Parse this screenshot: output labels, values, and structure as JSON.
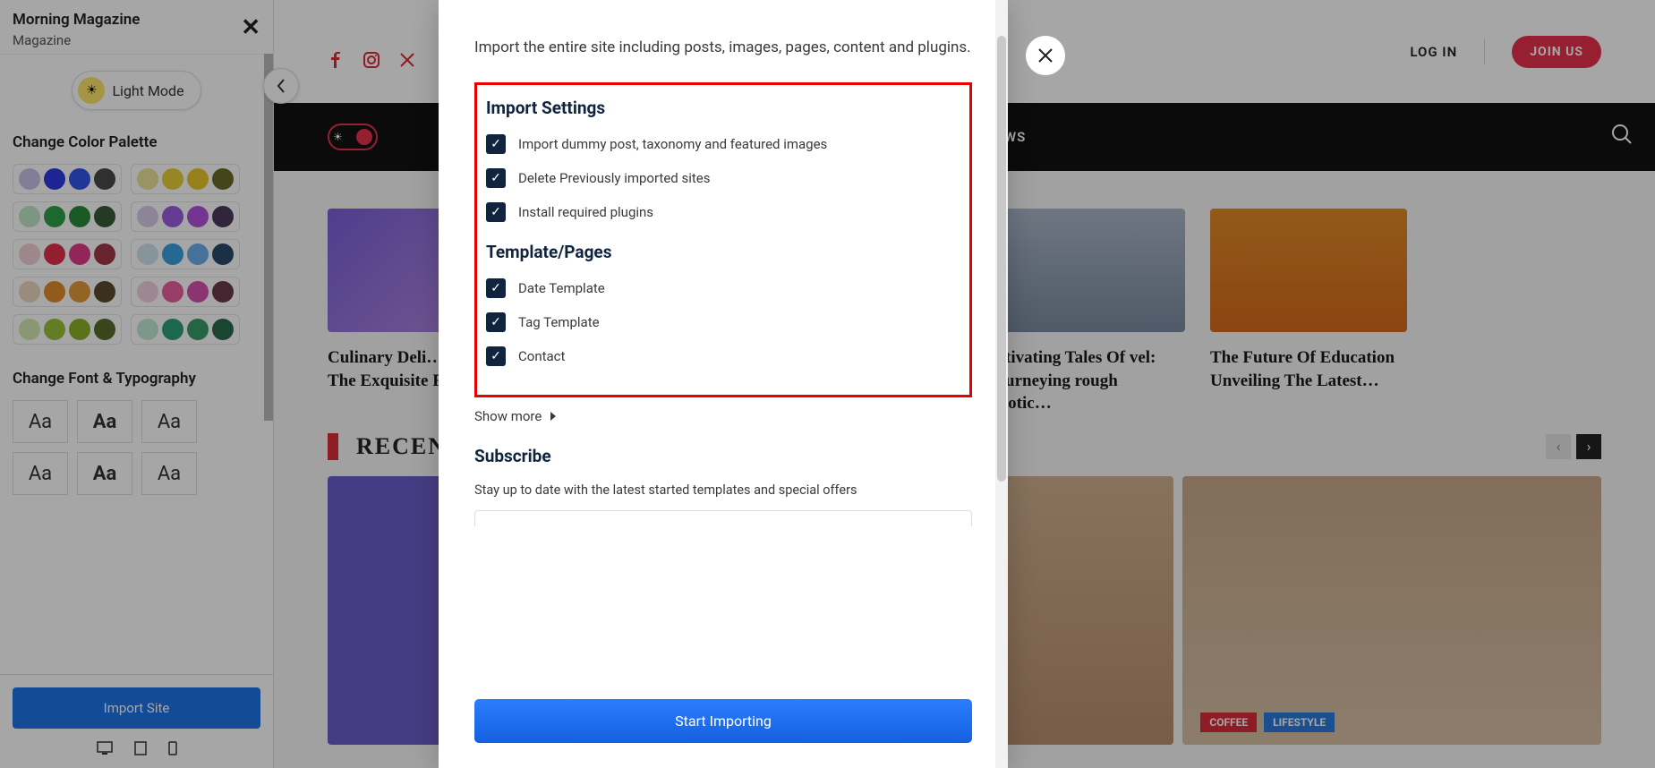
{
  "sidebar": {
    "title": "Morning Magazine",
    "subtitle": "Magazine",
    "light_mode": "Light Mode",
    "palette_label": "Change Color Palette",
    "font_label": "Change Font & Typography",
    "import_btn": "Import Site",
    "palettes": [
      [
        [
          "#c6c4ea",
          "#2b3adf",
          "#3355e8",
          "#4a4a4a"
        ],
        [
          "#ece39a",
          "#e6cf3a",
          "#e8c72a",
          "#6b6b2a"
        ]
      ],
      [
        [
          "#bfe6c7",
          "#2ea04a",
          "#2a8a3a",
          "#3a5a3a"
        ],
        [
          "#d8ccea",
          "#9a5fe0",
          "#b44fe0",
          "#4a3a5a"
        ]
      ],
      [
        [
          "#f2cfd4",
          "#e0314a",
          "#e03a8a",
          "#a03a4a"
        ],
        [
          "#cfe3ee",
          "#3aa0e0",
          "#6ab0ea",
          "#2a4a6a"
        ]
      ],
      [
        [
          "#ead9c0",
          "#e08a2a",
          "#e09a3a",
          "#5a4a2a"
        ],
        [
          "#f2cfe0",
          "#ea5fa0",
          "#d84fb0",
          "#6a3a4a"
        ]
      ],
      [
        [
          "#d6e8b0",
          "#9ac03a",
          "#8ab02a",
          "#5a6a2a"
        ],
        [
          "#c0ead6",
          "#2aa07a",
          "#3a9a6a",
          "#2a6a4a"
        ]
      ]
    ]
  },
  "preview": {
    "login": "LOG IN",
    "joinus": "JOIN US",
    "nav_link": "WS",
    "cards": [
      {
        "title": "Culinary Deli… Exploring The Exquisite Flav…",
        "bg": "linear-gradient(135deg,#7a5fd9,#b88fe0)"
      },
      {
        "title": "…tivating Tales Of vel: Journeying rough Exotic…",
        "bg": "linear-gradient(#aab6c8,#7a8aa0)"
      },
      {
        "title": "The Future Of Education Unveiling The Latest…",
        "bg": "linear-gradient(#e08a2a,#d86a1a)"
      }
    ],
    "recent": "RECENT",
    "chips": [
      "COFFEE",
      "LIFESTYLE"
    ]
  },
  "modal": {
    "description": "Import the entire site including posts, images, pages, content and plugins.",
    "import_settings_h": "Import Settings",
    "settings": [
      "Import dummy post, taxonomy and featured images",
      "Delete Previously imported sites",
      "Install required plugins"
    ],
    "template_h": "Template/Pages",
    "templates": [
      "Date Template",
      "Tag Template",
      "Contact"
    ],
    "show_more": "Show more",
    "subscribe_h": "Subscribe",
    "subscribe_desc": "Stay up to date with the latest started templates and special offers",
    "start_btn": "Start Importing"
  }
}
